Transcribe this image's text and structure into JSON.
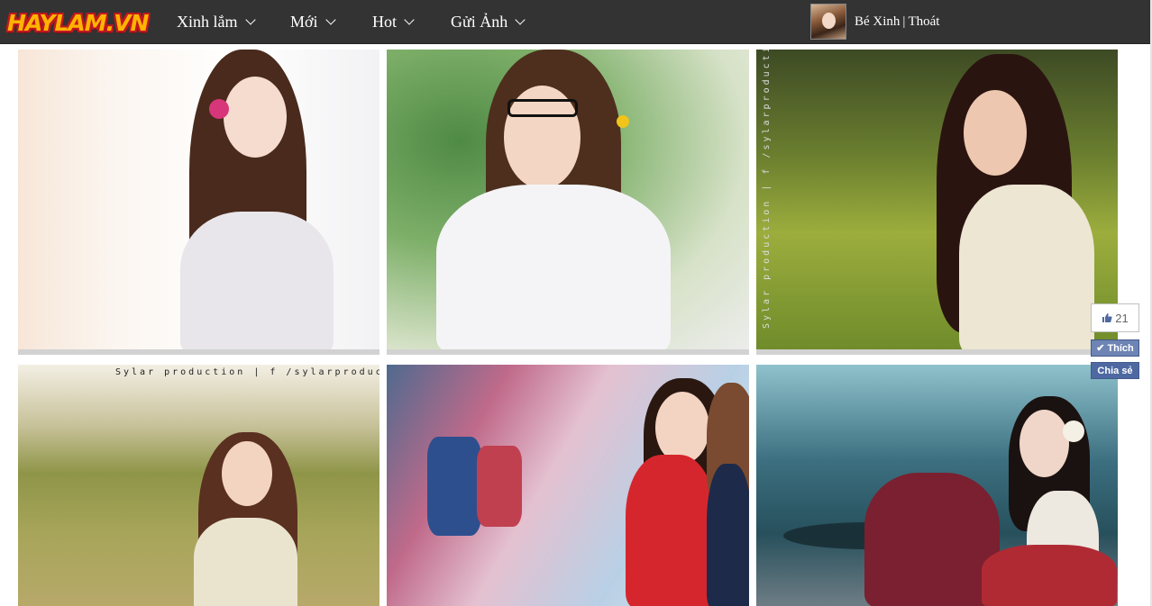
{
  "site": {
    "logo_text": "HAYLAM.VN"
  },
  "nav": [
    {
      "label": "Xinh lắm"
    },
    {
      "label": "Mới"
    },
    {
      "label": "Hot"
    },
    {
      "label": "Gửi Ảnh"
    }
  ],
  "user": {
    "name": "Bé Xinh",
    "separator": "|",
    "logout_label": "Thoát"
  },
  "gallery": {
    "watermark_horizontal": "Sylar production | f /sylarproduction",
    "watermark_vertical": "Sylar production | f /sylarproduction"
  },
  "social": {
    "like_count": "21",
    "like_button": "Thích",
    "share_button": "Chia sẻ"
  },
  "colors": {
    "topbar": "#333333",
    "facebook_blue": "#4e69a2",
    "logo_orange": "#ffb400",
    "logo_red": "#c0181f"
  }
}
